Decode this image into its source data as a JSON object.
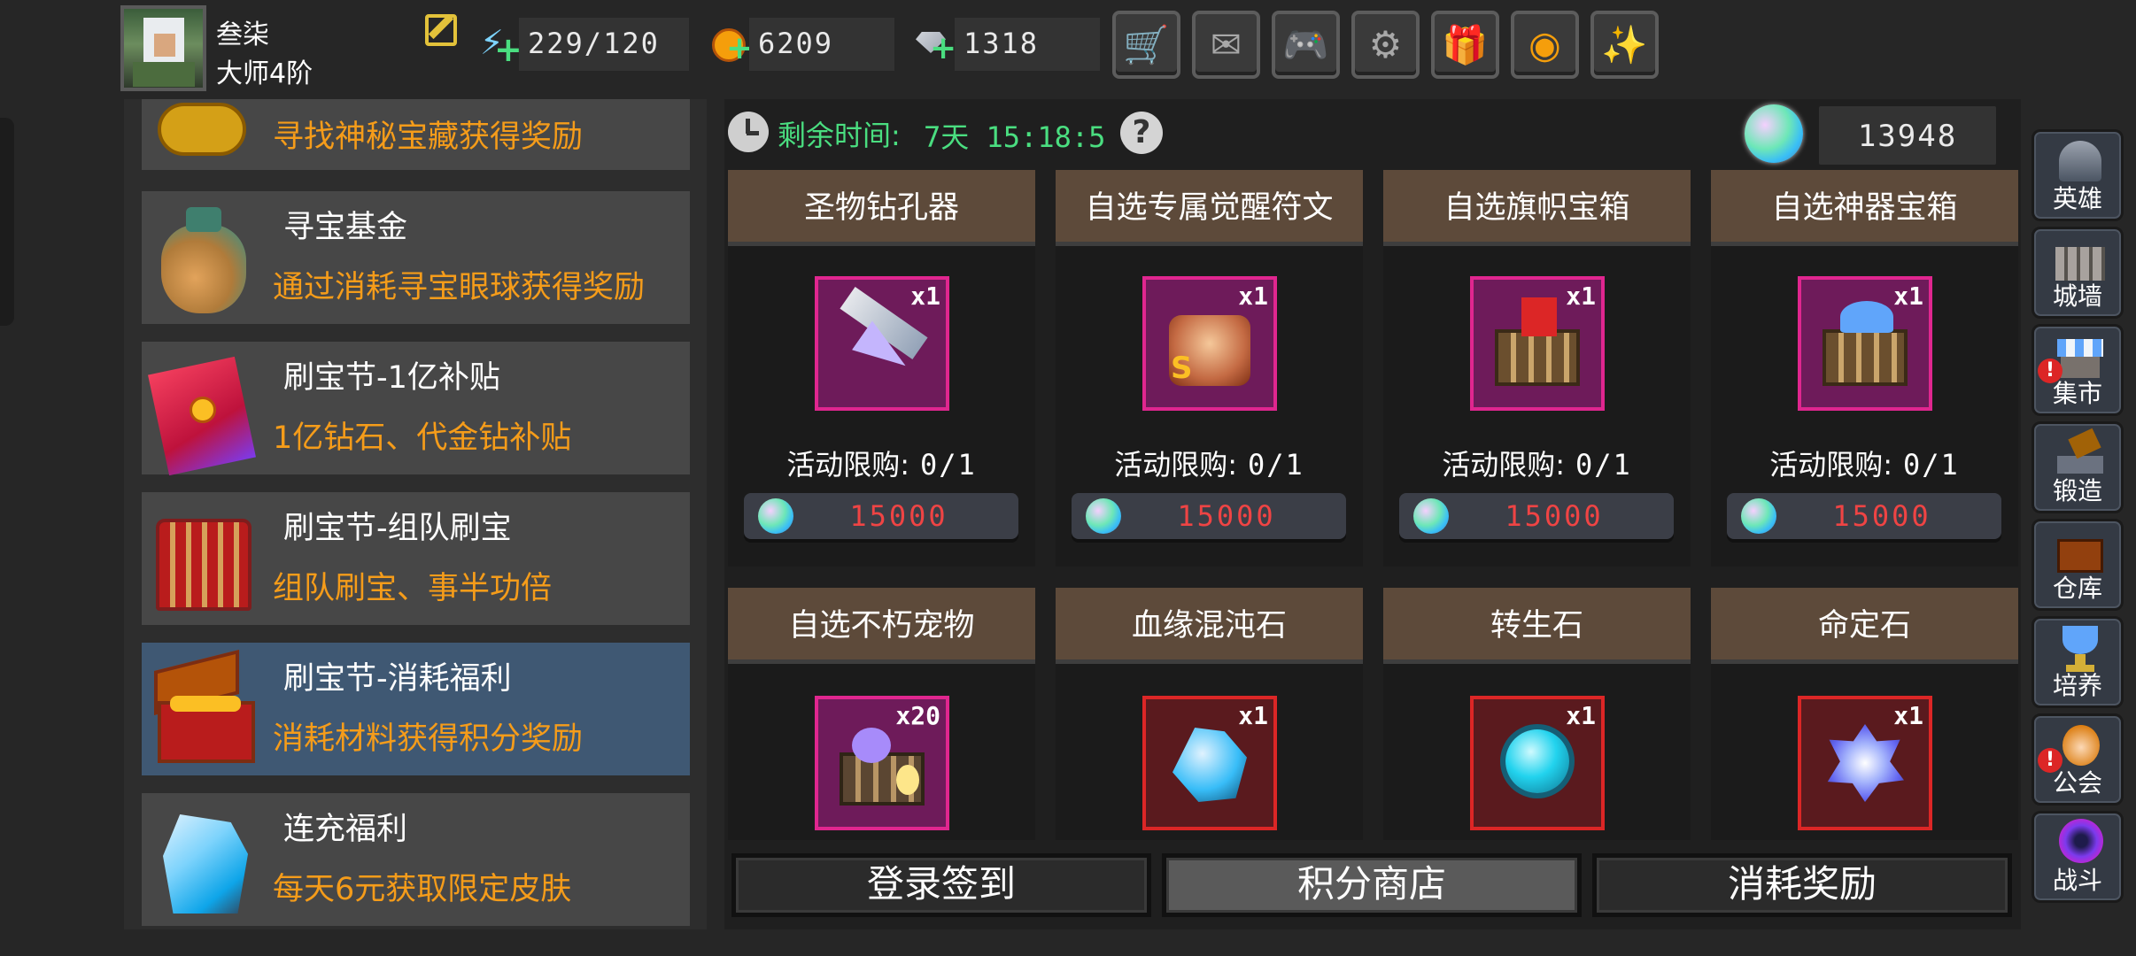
{
  "player": {
    "name": "叁柒",
    "rank": "大师4阶"
  },
  "resources": {
    "energy": "229/120",
    "gold": "6209",
    "gems": "1318"
  },
  "top_buttons": [
    {
      "name": "shop-cart-icon",
      "glyph": "🛒"
    },
    {
      "name": "mail-icon",
      "glyph": "✉"
    },
    {
      "name": "gamepad-icon",
      "glyph": "🎮"
    },
    {
      "name": "settings-gear-icon",
      "glyph": "⚙"
    },
    {
      "name": "gift-icon",
      "glyph": "🎁"
    },
    {
      "name": "color-wheel-icon",
      "glyph": "◉"
    },
    {
      "name": "fireworks-icon",
      "glyph": "✨"
    }
  ],
  "events": [
    {
      "title": "",
      "desc": "寻找神秘宝藏获得奖励"
    },
    {
      "title": "寻宝基金",
      "desc": "通过消耗寻宝眼球获得奖励"
    },
    {
      "title": "刷宝节-1亿补贴",
      "desc": "1亿钻石、代金钻补贴"
    },
    {
      "title": "刷宝节-组队刷宝",
      "desc": "组队刷宝、事半功倍"
    },
    {
      "title": "刷宝节-消耗福利",
      "desc": "消耗材料获得积分奖励"
    },
    {
      "title": "连充福利",
      "desc": "每天6元获取限定皮肤"
    }
  ],
  "shop": {
    "timer_label": "剩余时间:",
    "timer_value": "7天 15:18:5",
    "points": "13948",
    "limit_label": "活动限购:",
    "items": [
      {
        "name": "圣物钻孔器",
        "qty": "x1",
        "limit": "0/1",
        "price": "15000",
        "frame": "magenta"
      },
      {
        "name": "自选专属觉醒符文",
        "qty": "x1",
        "limit": "0/1",
        "price": "15000",
        "frame": "magenta"
      },
      {
        "name": "自选旗帜宝箱",
        "qty": "x1",
        "limit": "0/1",
        "price": "15000",
        "frame": "magenta"
      },
      {
        "name": "自选神器宝箱",
        "qty": "x1",
        "limit": "0/1",
        "price": "15000",
        "frame": "magenta"
      },
      {
        "name": "自选不朽宠物",
        "qty": "x20",
        "frame": "magenta"
      },
      {
        "name": "血缘混沌石",
        "qty": "x1",
        "frame": "red"
      },
      {
        "name": "转生石",
        "qty": "x1",
        "frame": "red"
      },
      {
        "name": "命定石",
        "qty": "x1",
        "frame": "red"
      }
    ]
  },
  "bottom_tabs": [
    {
      "label": "登录签到",
      "active": false
    },
    {
      "label": "积分商店",
      "active": true
    },
    {
      "label": "消耗奖励",
      "active": false
    }
  ],
  "right_nav": [
    {
      "label": "英雄",
      "icon": "hero-helmet-icon",
      "alert": false
    },
    {
      "label": "城墙",
      "icon": "city-wall-icon",
      "alert": false
    },
    {
      "label": "集市",
      "icon": "market-stall-icon",
      "alert": true
    },
    {
      "label": "锻造",
      "icon": "anvil-hammer-icon",
      "alert": false
    },
    {
      "label": "仓库",
      "icon": "warehouse-chest-icon",
      "alert": false
    },
    {
      "label": "培养",
      "icon": "trophy-chalice-icon",
      "alert": false
    },
    {
      "label": "公会",
      "icon": "guild-avatar-icon",
      "alert": true
    },
    {
      "label": "战斗",
      "icon": "battle-portal-icon",
      "alert": false
    }
  ],
  "colors": {
    "accent_orange": "#f59c1a",
    "timer_green": "#4ade80",
    "price_red": "#ef4444",
    "active_item_blue": "#3f5873",
    "frame_magenta": "#e0268f",
    "frame_red": "#dc2626"
  }
}
